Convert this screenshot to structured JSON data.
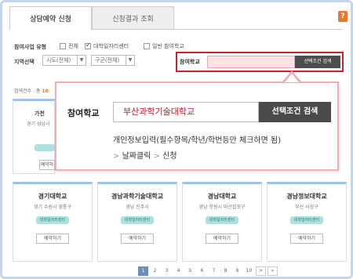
{
  "tabs": [
    {
      "label": "상담예약 신청"
    },
    {
      "label": "신청결과 조회"
    }
  ],
  "help_label": "?",
  "filters": {
    "type_label": "참여사업 유형",
    "type_options": [
      {
        "label": "전체",
        "checked": false
      },
      {
        "label": "대학일자리센터",
        "checked": true
      },
      {
        "label": "일반 참여학교",
        "checked": false
      }
    ],
    "region_label": "지역선택",
    "city_select": "시도(전체)",
    "district_select": "구군(전체)",
    "school_label": "참여학교",
    "search_button": "선택조건 검색"
  },
  "result_count_label": "검색건수 : 총",
  "result_count_value": "10",
  "partial_cards": [
    {
      "name": "가천",
      "addr": "경기 성남시"
    }
  ],
  "cards": [
    {
      "name": "경기대학교",
      "addr": "경기 수원시 영통구",
      "tag": "대학일자리센터",
      "button": "예약하기"
    },
    {
      "name": "경남과학기술대학교",
      "addr": "경남 진주시",
      "tag": "대학일자리센터",
      "button": "예약하기"
    },
    {
      "name": "경남대학교",
      "addr": "경남 창원시 마산합포구",
      "tag": "대학일자리센터",
      "button": "예약하기"
    },
    {
      "name": "경남정보대학교",
      "addr": "부산 사상구",
      "tag": "대학일자리센터",
      "button": "예약하기"
    }
  ],
  "hidden_row_buttons": [
    "예약하기",
    "예약하기"
  ],
  "callout": {
    "label": "참여학교",
    "input_value": "부산과학기술대학교",
    "button": "선택조건 검색",
    "desc_line1": "개인정보입력(필수항목/학년/학번등만 체크하면 됨)",
    "step1": "날짜클릭",
    "step2": "신청",
    "chevron": ">"
  },
  "pagination": {
    "pages": [
      "1",
      "2",
      "3",
      "4",
      "5",
      "6",
      "7",
      "8",
      "9",
      "10"
    ],
    "active": "1",
    "next": ">",
    "last": "»"
  },
  "colors": {
    "accent_red": "#d0202b",
    "tag_teal": "#aee0df",
    "card_top": "#9cc4ea",
    "pager_active": "#6d8fb5"
  }
}
